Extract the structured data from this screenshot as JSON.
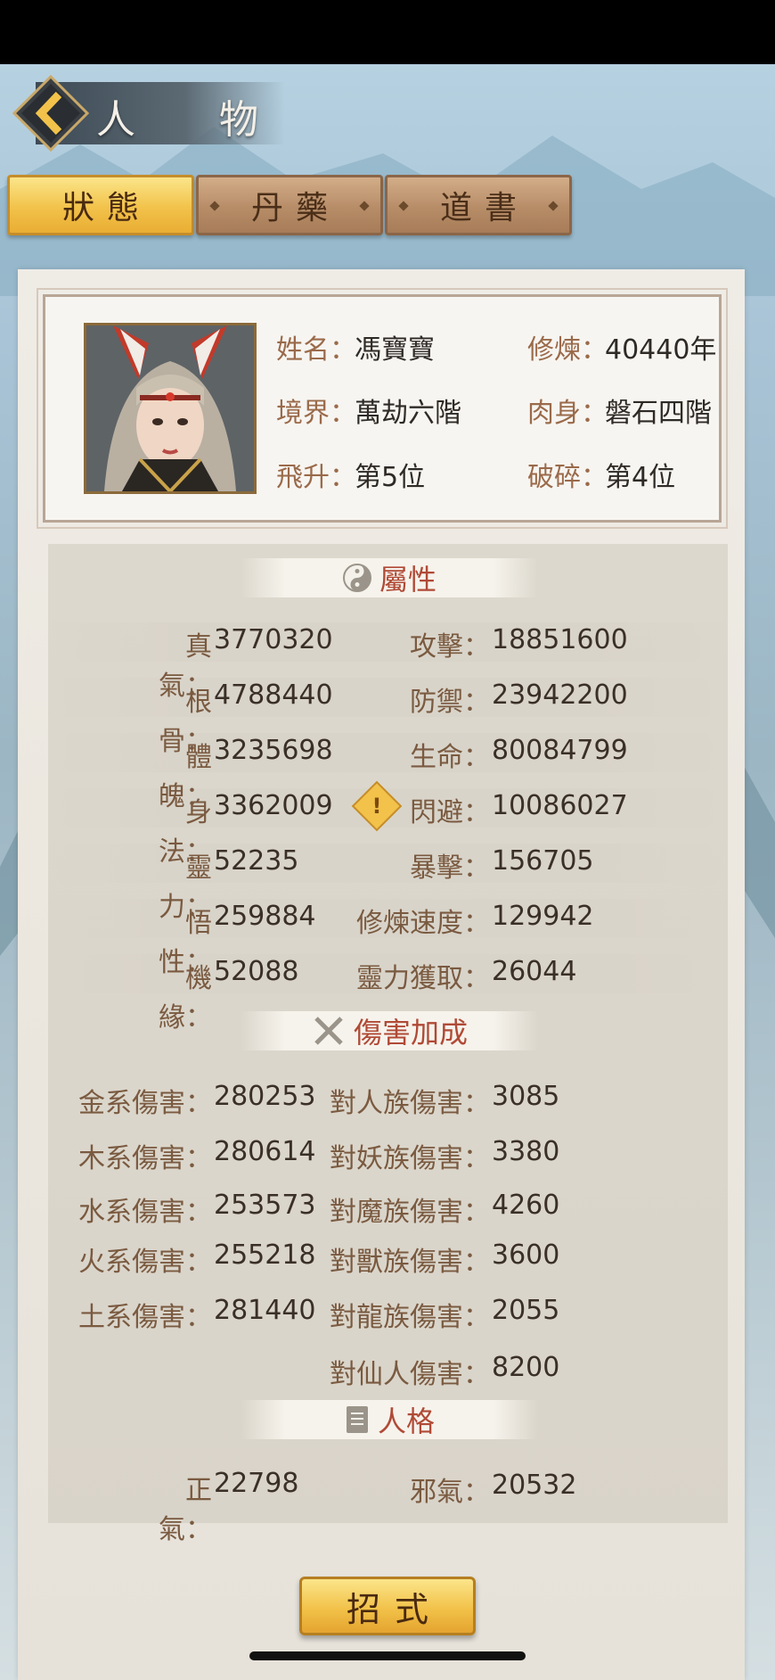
{
  "header": {
    "title": "人 物",
    "back_icon": "chevron-left-icon"
  },
  "tabs": [
    {
      "label": "狀態",
      "active": true
    },
    {
      "label": "丹藥",
      "active": false
    },
    {
      "label": "道書",
      "active": false
    }
  ],
  "profile": {
    "portrait_icon": "character-portrait",
    "fields": [
      {
        "label": "姓名",
        "value": "馮寶寶"
      },
      {
        "label": "修煉",
        "value": "40440年"
      },
      {
        "label": "境界",
        "value": "萬劫六階"
      },
      {
        "label": "肉身",
        "value": "磐石四階"
      },
      {
        "label": "飛升",
        "value": "第5位"
      },
      {
        "label": "破碎",
        "value": "第4位"
      }
    ]
  },
  "attributes": {
    "title": "屬性",
    "icon": "yin-yang-icon",
    "rows": [
      {
        "l_label": "真氣",
        "l_value": "3770320",
        "r_label": "攻擊",
        "r_value": "18851600"
      },
      {
        "l_label": "根骨",
        "l_value": "4788440",
        "r_label": "防禦",
        "r_value": "23942200"
      },
      {
        "l_label": "體魄",
        "l_value": "3235698",
        "r_label": "生命",
        "r_value": "80084799"
      },
      {
        "l_label": "身法",
        "l_value": "3362009",
        "r_label": "閃避",
        "r_value": "10086027"
      },
      {
        "l_label": "靈力",
        "l_value": "52235",
        "r_label": "暴擊",
        "r_value": "156705"
      },
      {
        "l_label": "悟性",
        "l_value": "259884",
        "r_label": "修煉速度",
        "r_value": "129942"
      },
      {
        "l_label": "機緣",
        "l_value": "52088",
        "r_label": "靈力獲取",
        "r_value": "26044"
      }
    ]
  },
  "damage": {
    "title": "傷害加成",
    "icon": "crossed-swords-icon",
    "rows": [
      {
        "l_label": "金系傷害",
        "l_value": "280253",
        "r_label": "對人族傷害",
        "r_value": "3085"
      },
      {
        "l_label": "木系傷害",
        "l_value": "280614",
        "r_label": "對妖族傷害",
        "r_value": "3380"
      },
      {
        "l_label": "水系傷害",
        "l_value": "253573",
        "r_label": "對魔族傷害",
        "r_value": "4260"
      },
      {
        "l_label": "火系傷害",
        "l_value": "255218",
        "r_label": "對獸族傷害",
        "r_value": "3600"
      },
      {
        "l_label": "土系傷害",
        "l_value": "281440",
        "r_label": "對龍族傷害",
        "r_value": "2055"
      },
      {
        "l_label": "",
        "l_value": "",
        "r_label": "對仙人傷害",
        "r_value": "8200"
      }
    ]
  },
  "personality": {
    "title": "人格",
    "icon": "scroll-icon",
    "rows": [
      {
        "l_label": "正氣",
        "l_value": "22798",
        "r_label": "邪氣",
        "r_value": "20532"
      }
    ]
  },
  "skill_button": {
    "label": "招式"
  },
  "colors": {
    "accent_gold": "#f2c24a",
    "section_title": "#b04a36",
    "label_brown": "#7a5a40"
  }
}
